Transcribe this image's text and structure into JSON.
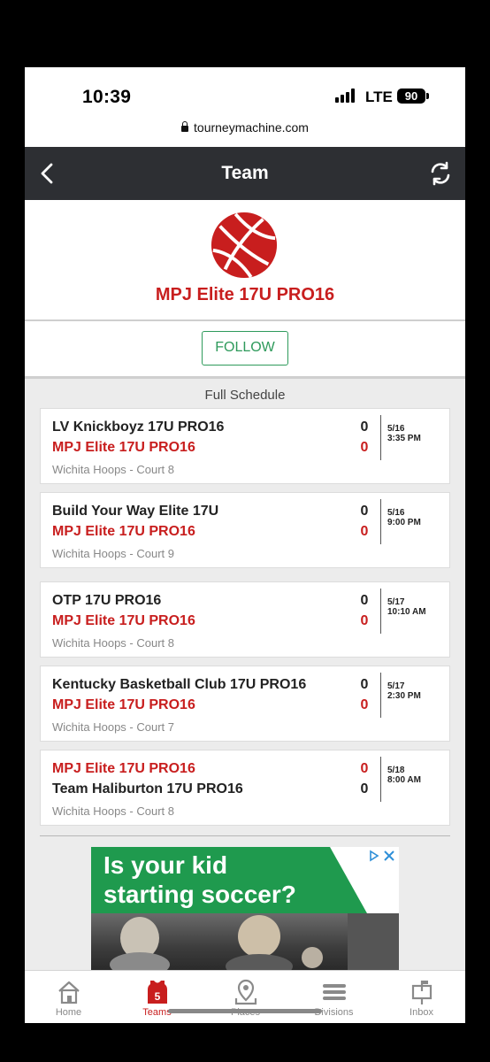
{
  "status_bar": {
    "time": "10:39",
    "network": "LTE",
    "battery": "90"
  },
  "browser": {
    "url": "tourneymachine.com"
  },
  "header": {
    "title": "Team"
  },
  "team": {
    "name": "MPJ Elite 17U PRO16"
  },
  "follow": {
    "label": "FOLLOW"
  },
  "schedule": {
    "heading": "Full Schedule",
    "games": [
      {
        "team1": "LV Knickboyz 17U PRO16",
        "score1": "0",
        "team2": "MPJ Elite 17U PRO16",
        "score2": "0",
        "venue": "Wichita Hoops - Court 8",
        "date": "5/16",
        "time": "3:35 PM"
      },
      {
        "team1": "Build Your Way Elite 17U",
        "score1": "0",
        "team2": "MPJ Elite 17U PRO16",
        "score2": "0",
        "venue": "Wichita Hoops - Court 9",
        "date": "5/16",
        "time": "9:00 PM"
      },
      {
        "team1": "OTP 17U PRO16",
        "score1": "0",
        "team2": "MPJ Elite 17U PRO16",
        "score2": "0",
        "venue": "Wichita Hoops - Court 8",
        "date": "5/17",
        "time": "10:10 AM"
      },
      {
        "team1": "Kentucky Basketball Club 17U PRO16",
        "score1": "0",
        "team2": "MPJ Elite 17U PRO16",
        "score2": "0",
        "venue": "Wichita Hoops - Court 7",
        "date": "5/17",
        "time": "2:30 PM"
      },
      {
        "team1": "MPJ Elite 17U PRO16",
        "score1": "0",
        "team2": "Team Haliburton 17U PRO16",
        "score2": "0",
        "venue": "Wichita Hoops - Court 8",
        "date": "5/18",
        "time": "8:00 AM"
      }
    ]
  },
  "ad": {
    "line1": "Is your kid",
    "line2": "starting soccer?"
  },
  "nav": {
    "items": [
      {
        "label": "Home",
        "icon": "home-icon"
      },
      {
        "label": "Teams",
        "icon": "jersey-icon",
        "badge": "5"
      },
      {
        "label": "Places",
        "icon": "map-pin-icon"
      },
      {
        "label": "Divisions",
        "icon": "menu-lines-icon"
      },
      {
        "label": "Inbox",
        "icon": "mailbox-icon"
      }
    ]
  },
  "colors": {
    "brand_red": "#c81e1e",
    "header_bg": "#2d2f33",
    "follow_green": "#2e9a5b",
    "ad_green": "#1f9a4e"
  }
}
